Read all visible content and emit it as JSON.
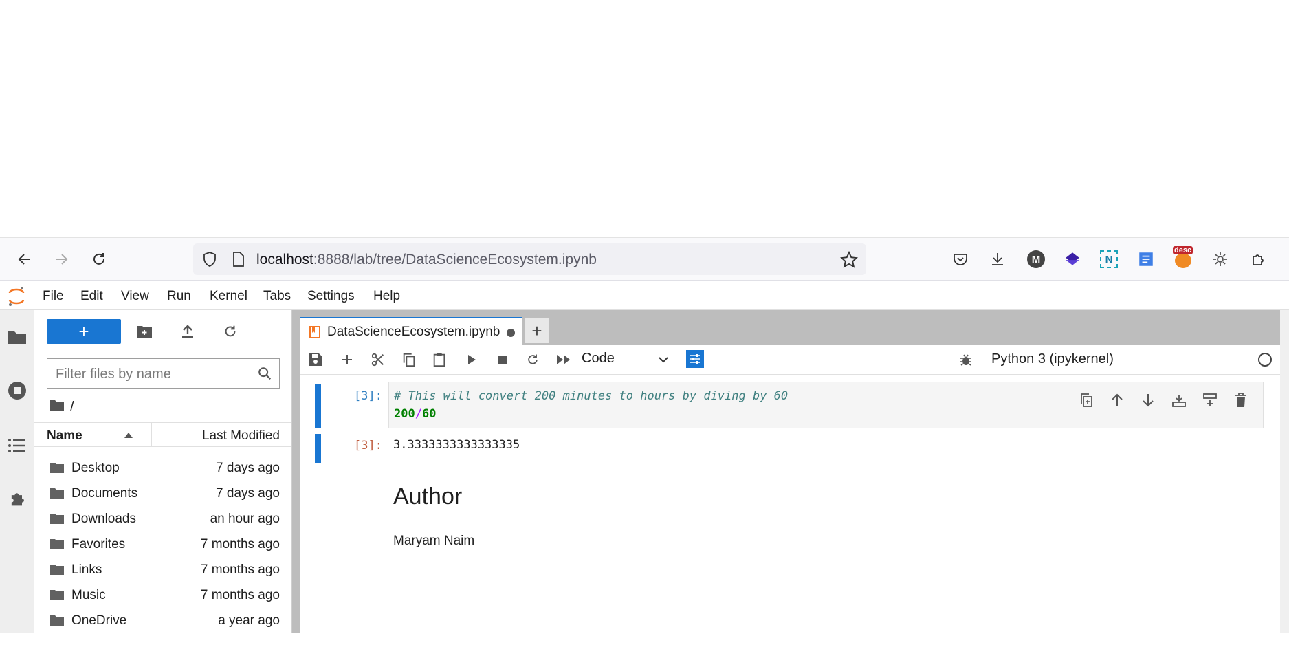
{
  "browser": {
    "url_host": "localhost",
    "url_rest": ":8888/lab/tree/DataScienceEcosystem.ipynb",
    "icons": [
      "back-icon",
      "forward-icon",
      "reload-icon",
      "shield-icon",
      "page-icon",
      "star-icon",
      "pocket-icon",
      "download-icon",
      "account-icon",
      "extension-icon",
      "puzzle-icon"
    ],
    "account_letter": "M",
    "desc_badge": "desc"
  },
  "menu": {
    "items": [
      "File",
      "Edit",
      "View",
      "Run",
      "Kernel",
      "Tabs",
      "Settings",
      "Help"
    ]
  },
  "filebrowser": {
    "new_label": "+",
    "filter_placeholder": "Filter files by name",
    "breadcrumb": "/",
    "col_name": "Name",
    "col_modified": "Last Modified",
    "files": [
      {
        "name": "Desktop",
        "modified": "7 days ago"
      },
      {
        "name": "Documents",
        "modified": "7 days ago"
      },
      {
        "name": "Downloads",
        "modified": "an hour ago"
      },
      {
        "name": "Favorites",
        "modified": "7 months ago"
      },
      {
        "name": "Links",
        "modified": "7 months ago"
      },
      {
        "name": "Music",
        "modified": "7 months ago"
      },
      {
        "name": "OneDrive",
        "modified": "a year ago"
      }
    ]
  },
  "notebook": {
    "tab_title": "DataScienceEcosystem.ipynb",
    "tab_add": "+",
    "cell_type": "Code",
    "kernel": "Python 3 (ipykernel)",
    "in_prompt": "[3]:",
    "code_comment": "# This will convert 200 minutes to hours by diving by 60",
    "code_num1": "200",
    "code_op": "/",
    "code_num2": "60",
    "out_prompt": "[3]:",
    "output": "3.3333333333333335",
    "md_heading": "Author",
    "md_text": "Maryam Naim"
  },
  "colors": {
    "accent": "#1976d2",
    "prompt_in": "#307fc1",
    "prompt_out": "#bf5b3d",
    "comment": "#408080",
    "number": "#008000",
    "operator": "#aa22ff"
  }
}
